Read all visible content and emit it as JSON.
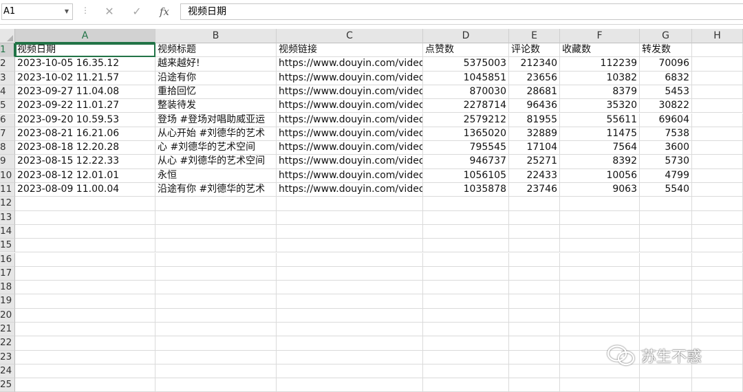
{
  "formula_bar": {
    "name_box": "A1",
    "cancel_icon": "✕",
    "enter_icon": "✓",
    "fx_label": "fx",
    "content": "视频日期"
  },
  "columns": [
    "A",
    "B",
    "C",
    "D",
    "E",
    "F",
    "G",
    "H"
  ],
  "row_count": 25,
  "selected_column": "A",
  "selected_row": 1,
  "table": {
    "rows": [
      [
        "视频日期",
        "视频标题",
        "视频链接",
        "点赞数",
        "评论数",
        "收藏数",
        "转发数"
      ],
      [
        "2023-10-05 16.35.12",
        "越来越好!",
        "https://www.douyin.com/video",
        "5375003",
        "212340",
        "112239",
        "70096"
      ],
      [
        "2023-10-02 11.21.57",
        "沿途有你",
        "https://www.douyin.com/video",
        "1045851",
        "23656",
        "10382",
        "6832"
      ],
      [
        "2023-09-27 11.04.08",
        "重拾回忆",
        "https://www.douyin.com/video",
        "870030",
        "28681",
        "8379",
        "5453"
      ],
      [
        "2023-09-22 11.01.27",
        "整装待发",
        "https://www.douyin.com/video",
        "2278714",
        "96436",
        "35320",
        "30822"
      ],
      [
        "2023-09-20 10.59.53",
        "登场 #登场对唱助威亚运",
        "https://www.douyin.com/video",
        "2579212",
        "81955",
        "55611",
        "69604"
      ],
      [
        "2023-08-21 16.21.06",
        "从心开始 #刘德华的艺术",
        "https://www.douyin.com/video",
        "1365020",
        "32889",
        "11475",
        "7538"
      ],
      [
        "2023-08-18 12.20.28",
        "心 #刘德华的艺术空间",
        "https://www.douyin.com/video",
        "795545",
        "17104",
        "7564",
        "3600"
      ],
      [
        "2023-08-15 12.22.33",
        "从心 #刘德华的艺术空间",
        "https://www.douyin.com/video",
        "946737",
        "25271",
        "8392",
        "5730"
      ],
      [
        "2023-08-12 12.01.01",
        "永恒",
        "https://www.douyin.com/video",
        "1056105",
        "22433",
        "10056",
        "4799"
      ],
      [
        "2023-08-09 11.00.04",
        "沿途有你 #刘德华的艺术",
        "https://www.douyin.com/video",
        "1035878",
        "23746",
        "9063",
        "5540"
      ]
    ]
  },
  "watermark": {
    "icon": "wechat-icon",
    "text": "苏生不惑"
  },
  "colors": {
    "accent": "#217346",
    "header_bg": "#e6e6e6",
    "gridline": "#dadada"
  }
}
